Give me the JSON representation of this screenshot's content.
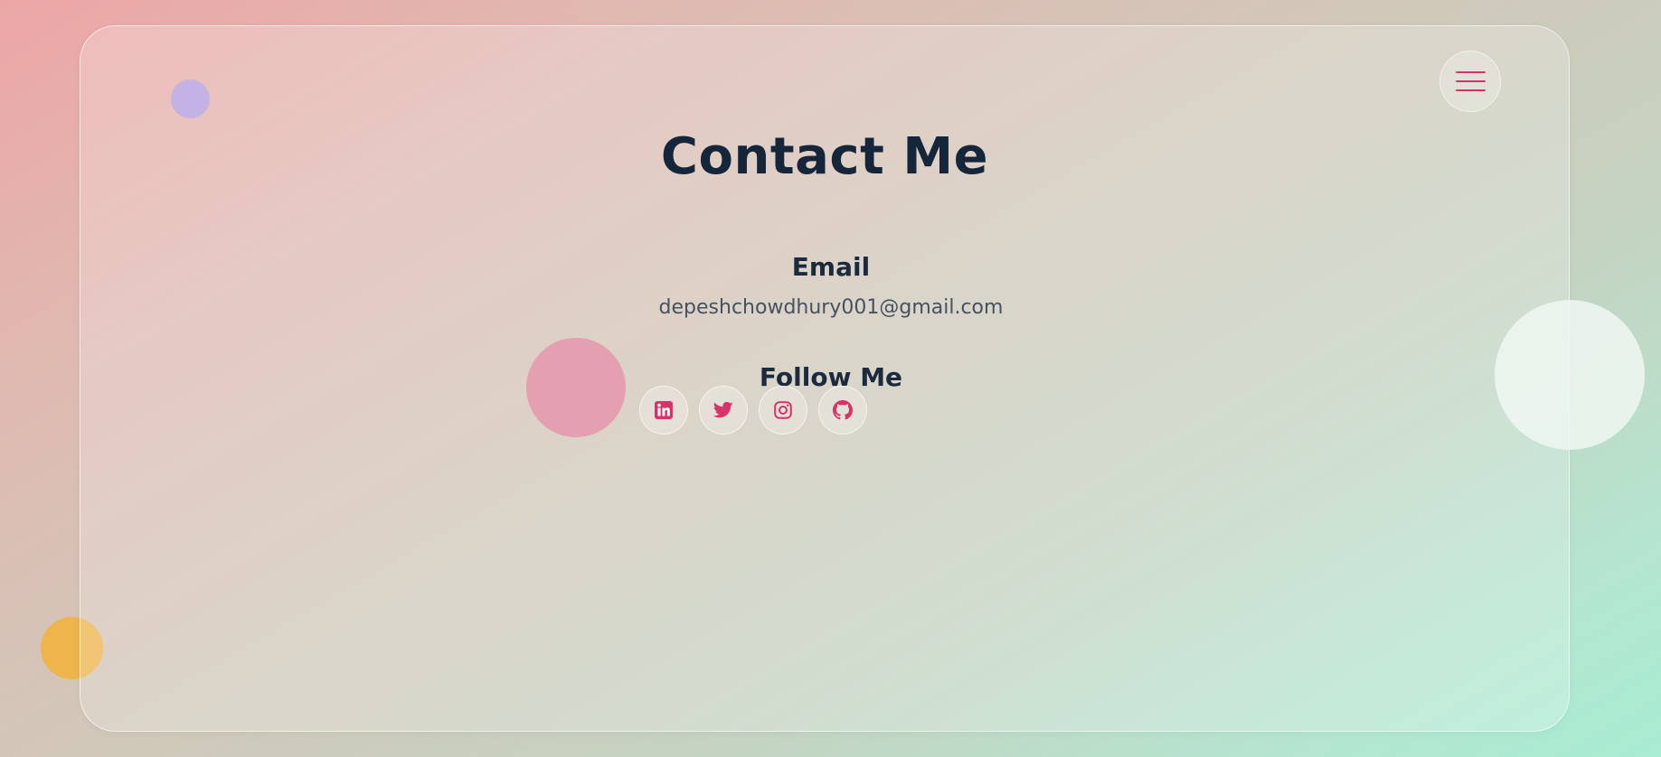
{
  "header": {
    "menu_icon": "hamburger-menu-icon"
  },
  "main": {
    "title": "Contact Me",
    "email": {
      "heading": "Email",
      "address": "depeshchowdhury001@gmail.com"
    },
    "follow": {
      "heading": "Follow Me",
      "links": [
        {
          "icon": "linkedin-icon"
        },
        {
          "icon": "twitter-icon"
        },
        {
          "icon": "instagram-icon"
        },
        {
          "icon": "github-icon"
        }
      ]
    }
  },
  "colors": {
    "accent": "#d7336a",
    "heading": "#15263b",
    "text_muted": "#455262",
    "blob_purple": "#b29ddc",
    "blob_pink": "#e49fb1",
    "blob_orange": "#eeb54c",
    "blob_white": "#eef5f0"
  }
}
